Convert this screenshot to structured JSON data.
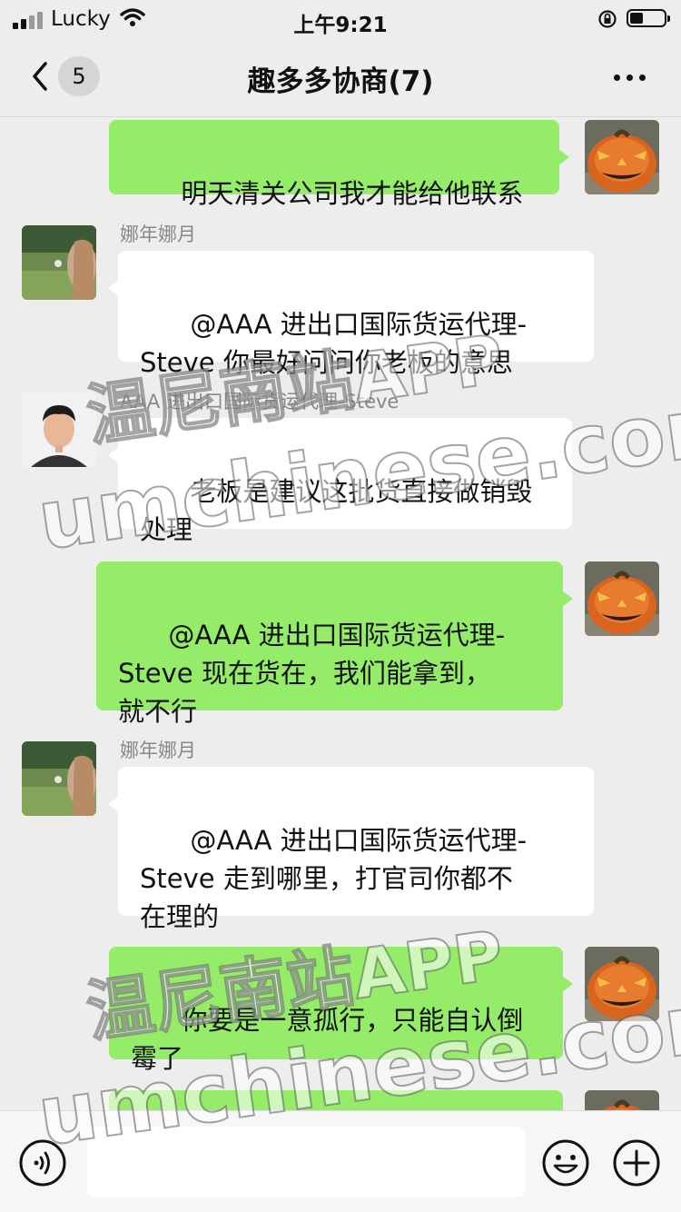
{
  "status_bar": {
    "carrier": "Lucky",
    "time": "上午9:21"
  },
  "nav": {
    "back_badge": "5",
    "title": "趣多多协商(7)"
  },
  "messages": [
    {
      "side": "me",
      "avatar": "pumpkin-avatar",
      "text": "明天清关公司我才能给他联系"
    },
    {
      "side": "other",
      "sender": "娜年娜月",
      "avatar": "girl-field-avatar",
      "text": "@AAA 进出口国际货运代理-\nSteve 你最好问问你老板的意思"
    },
    {
      "side": "other",
      "sender": "AAA 进出口国际货运代理-Steve",
      "avatar": "man-portrait-avatar",
      "text": "老板是建议这批货直接做销毁\n处理"
    },
    {
      "side": "me",
      "avatar": "pumpkin-avatar",
      "text": "@AAA 进出口国际货运代理-\nSteve 现在货在，我们能拿到，\n就不行"
    },
    {
      "side": "other",
      "sender": "娜年娜月",
      "avatar": "girl-field-avatar",
      "text": "@AAA 进出口国际货运代理-\nSteve 走到哪里，打官司你都不\n在理的"
    },
    {
      "side": "me",
      "avatar": "pumpkin-avatar",
      "text": "你要是一意孤行，只能自认倒\n霉了"
    },
    {
      "side": "me",
      "avatar": "pumpkin-avatar",
      "text": ""
    }
  ],
  "watermark": {
    "line1": "温尼南站APP",
    "line2": "umchinese.com"
  },
  "colors": {
    "my_bubble": "#95ec69",
    "other_bubble": "#ffffff",
    "background": "#ededed"
  }
}
